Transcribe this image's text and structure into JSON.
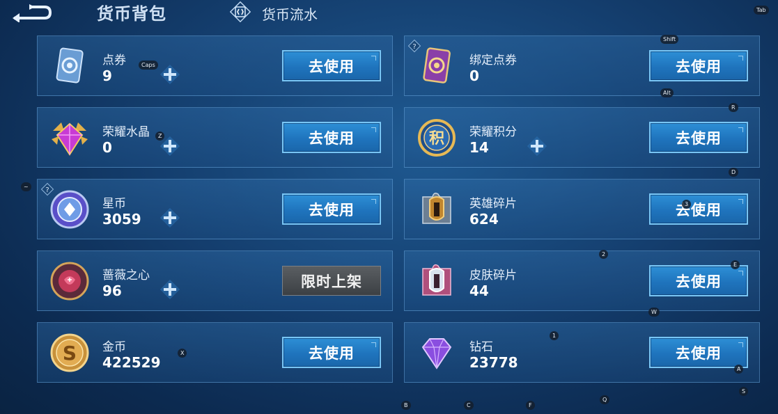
{
  "header": {
    "tab_wallet": "货币背包",
    "tab_flow": "货币流水"
  },
  "cards": [
    {
      "name": "点券",
      "amount": "9",
      "action": "去使用",
      "icon": "voucher-card-icon",
      "has_plus": true
    },
    {
      "name": "绑定点券",
      "amount": "0",
      "action": "去使用",
      "icon": "bound-voucher-card-icon",
      "has_plus": false
    },
    {
      "name": "荣耀水晶",
      "amount": "0",
      "action": "去使用",
      "icon": "glory-crystal-icon",
      "has_plus": true
    },
    {
      "name": "荣耀积分",
      "amount": "14",
      "action": "去使用",
      "icon": "glory-points-coin-icon",
      "has_plus": true
    },
    {
      "name": "星币",
      "amount": "3059",
      "action": "去使用",
      "icon": "star-coin-icon",
      "has_plus": true
    },
    {
      "name": "英雄碎片",
      "amount": "624",
      "action": "去使用",
      "icon": "hero-fragment-icon",
      "has_plus": false
    },
    {
      "name": "蔷薇之心",
      "amount": "96",
      "action": "限时上架",
      "icon": "rose-heart-icon",
      "has_plus": true
    },
    {
      "name": "皮肤碎片",
      "amount": "44",
      "action": "去使用",
      "icon": "skin-fragment-icon",
      "has_plus": false
    },
    {
      "name": "金币",
      "amount": "422529",
      "action": "去使用",
      "icon": "gold-coin-icon",
      "has_plus": true
    },
    {
      "name": "钻石",
      "amount": "23778",
      "action": "去使用",
      "icon": "diamond-icon",
      "has_plus": false
    }
  ],
  "key_hints": [
    "Tab",
    "Shift",
    "Caps",
    "Alt",
    "R",
    "Z",
    "D",
    "~",
    "3",
    "2",
    "E",
    "W",
    "X",
    "1",
    "A",
    "S",
    "B",
    "C",
    "F",
    "Q"
  ]
}
